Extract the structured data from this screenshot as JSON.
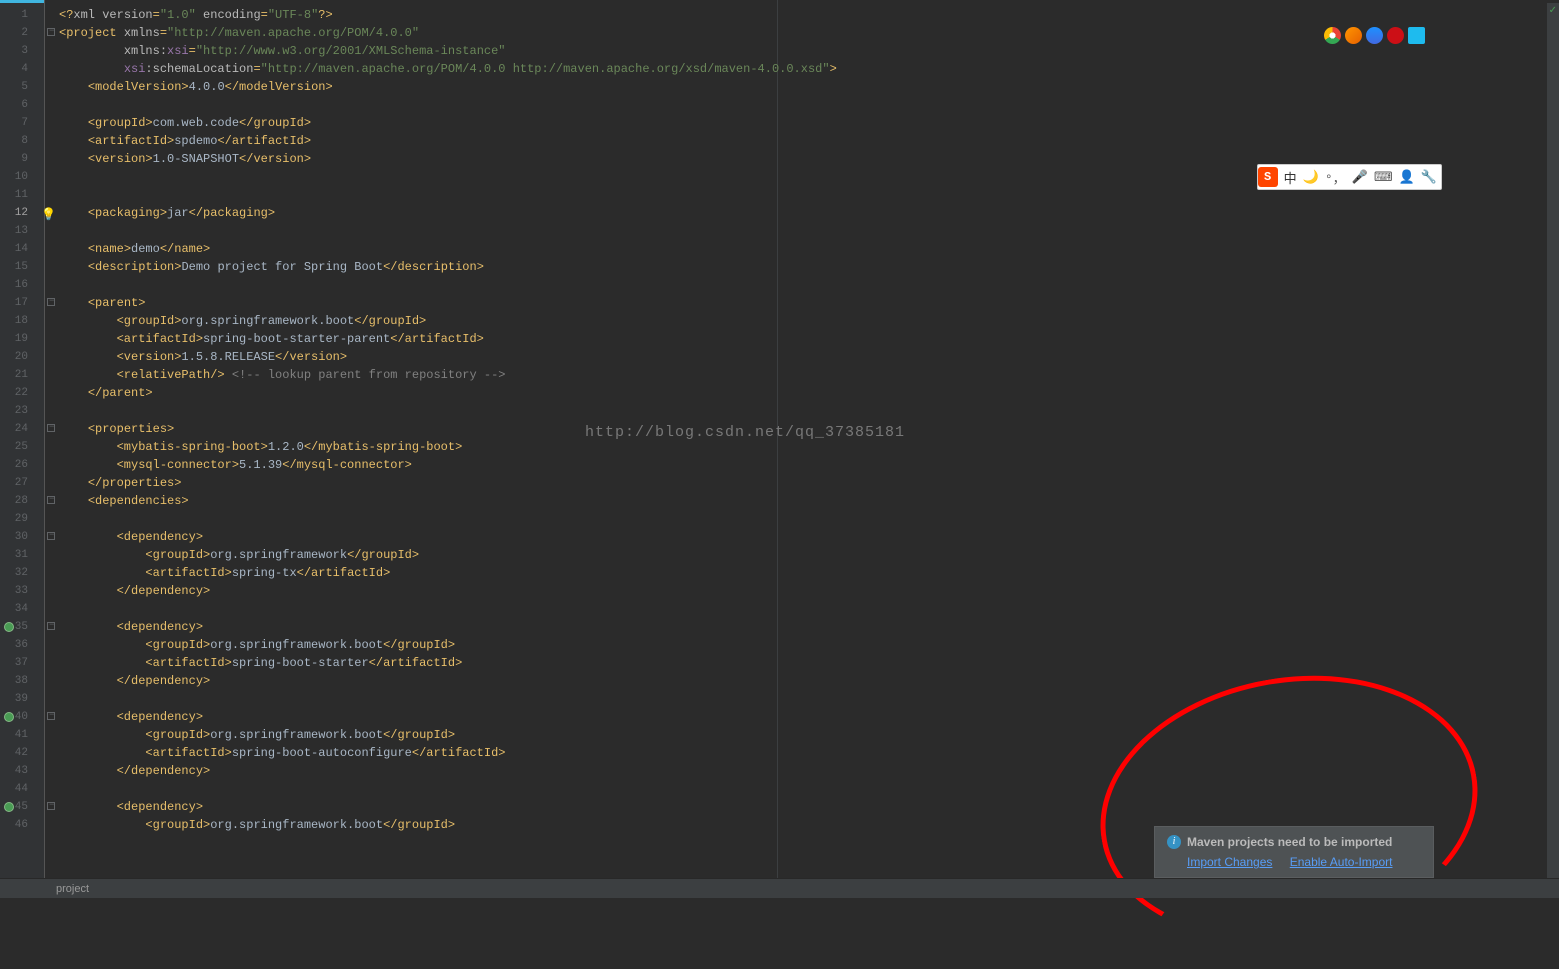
{
  "status_bar": {
    "breadcrumb": "project"
  },
  "notification": {
    "title": "Maven projects need to be imported",
    "link1": "Import Changes",
    "link2": "Enable Auto-Import"
  },
  "watermark": "http://blog.csdn.net/qq_37385181",
  "code": {
    "lines": [
      {
        "n": 1,
        "pre": "",
        "parts": [
          {
            "c": "tag",
            "t": "<?"
          },
          {
            "c": "attr",
            "t": "xml version"
          },
          {
            "c": "tag",
            "t": "="
          },
          {
            "c": "str",
            "t": "\"1.0\""
          },
          {
            "c": "attr",
            "t": " encoding"
          },
          {
            "c": "tag",
            "t": "="
          },
          {
            "c": "str",
            "t": "\"UTF-8\""
          },
          {
            "c": "tag",
            "t": "?>"
          }
        ]
      },
      {
        "n": 2,
        "pre": "",
        "fold": true,
        "parts": [
          {
            "c": "tag",
            "t": "<project "
          },
          {
            "c": "attr",
            "t": "xmlns"
          },
          {
            "c": "tag",
            "t": "="
          },
          {
            "c": "str",
            "t": "\"http://maven.apache.org/POM/4.0.0\""
          }
        ]
      },
      {
        "n": 3,
        "pre": "         ",
        "parts": [
          {
            "c": "attr",
            "t": "xmlns:"
          },
          {
            "c": "attrns",
            "t": "xsi"
          },
          {
            "c": "tag",
            "t": "="
          },
          {
            "c": "str",
            "t": "\"http://www.w3.org/2001/XMLSchema-instance\""
          }
        ]
      },
      {
        "n": 4,
        "pre": "         ",
        "parts": [
          {
            "c": "attrns",
            "t": "xsi"
          },
          {
            "c": "attr",
            "t": ":schemaLocation"
          },
          {
            "c": "tag",
            "t": "="
          },
          {
            "c": "str",
            "t": "\"http://maven.apache.org/POM/4.0.0 http://maven.apache.org/xsd/maven-4.0.0.xsd\""
          },
          {
            "c": "tag",
            "t": ">"
          }
        ]
      },
      {
        "n": 5,
        "pre": "    ",
        "parts": [
          {
            "c": "tag",
            "t": "<modelVersion>"
          },
          {
            "c": "txt",
            "t": "4.0.0"
          },
          {
            "c": "tag",
            "t": "</modelVersion>"
          }
        ]
      },
      {
        "n": 6,
        "pre": "",
        "parts": []
      },
      {
        "n": 7,
        "pre": "    ",
        "parts": [
          {
            "c": "tag",
            "t": "<groupId>"
          },
          {
            "c": "txt",
            "t": "com.web.code"
          },
          {
            "c": "tag",
            "t": "</groupId>"
          }
        ]
      },
      {
        "n": 8,
        "pre": "    ",
        "parts": [
          {
            "c": "tag",
            "t": "<artifactId>"
          },
          {
            "c": "txt",
            "t": "spdemo"
          },
          {
            "c": "tag",
            "t": "</artifactId>"
          }
        ]
      },
      {
        "n": 9,
        "pre": "    ",
        "parts": [
          {
            "c": "tag",
            "t": "<version>"
          },
          {
            "c": "txt",
            "t": "1.0-SNAPSHOT"
          },
          {
            "c": "tag",
            "t": "</version>"
          }
        ]
      },
      {
        "n": 10,
        "pre": "",
        "parts": []
      },
      {
        "n": 11,
        "pre": "",
        "parts": []
      },
      {
        "n": 12,
        "pre": "    ",
        "bulb": true,
        "active": true,
        "parts": [
          {
            "c": "tag",
            "t": "<packaging>"
          },
          {
            "c": "txt",
            "t": "jar"
          },
          {
            "c": "tag",
            "t": "</packaging>"
          }
        ]
      },
      {
        "n": 13,
        "pre": "",
        "parts": []
      },
      {
        "n": 14,
        "pre": "    ",
        "parts": [
          {
            "c": "tag",
            "t": "<name>"
          },
          {
            "c": "txt",
            "t": "demo"
          },
          {
            "c": "tag",
            "t": "</name>"
          }
        ]
      },
      {
        "n": 15,
        "pre": "    ",
        "parts": [
          {
            "c": "tag",
            "t": "<description>"
          },
          {
            "c": "txt",
            "t": "Demo project for Spring Boot"
          },
          {
            "c": "tag",
            "t": "</description>"
          }
        ]
      },
      {
        "n": 16,
        "pre": "",
        "parts": []
      },
      {
        "n": 17,
        "pre": "    ",
        "fold": true,
        "parts": [
          {
            "c": "tag",
            "t": "<parent>"
          }
        ]
      },
      {
        "n": 18,
        "pre": "        ",
        "parts": [
          {
            "c": "tag",
            "t": "<groupId>"
          },
          {
            "c": "txt",
            "t": "org.springframework.boot"
          },
          {
            "c": "tag",
            "t": "</groupId>"
          }
        ]
      },
      {
        "n": 19,
        "pre": "        ",
        "parts": [
          {
            "c": "tag",
            "t": "<artifactId>"
          },
          {
            "c": "txt",
            "t": "spring-boot-starter-parent"
          },
          {
            "c": "tag",
            "t": "</artifactId>"
          }
        ]
      },
      {
        "n": 20,
        "pre": "        ",
        "parts": [
          {
            "c": "tag",
            "t": "<version>"
          },
          {
            "c": "txt",
            "t": "1.5.8.RELEASE"
          },
          {
            "c": "tag",
            "t": "</version>"
          }
        ]
      },
      {
        "n": 21,
        "pre": "        ",
        "parts": [
          {
            "c": "tag",
            "t": "<relativePath/>"
          },
          {
            "c": "txt",
            "t": " "
          },
          {
            "c": "comment",
            "t": "<!-- lookup parent from repository -->"
          }
        ]
      },
      {
        "n": 22,
        "pre": "    ",
        "parts": [
          {
            "c": "tag",
            "t": "</parent>"
          }
        ]
      },
      {
        "n": 23,
        "pre": "",
        "parts": []
      },
      {
        "n": 24,
        "pre": "    ",
        "fold": true,
        "parts": [
          {
            "c": "tag",
            "t": "<properties>"
          }
        ]
      },
      {
        "n": 25,
        "pre": "        ",
        "parts": [
          {
            "c": "tag",
            "t": "<mybatis-spring-boot>"
          },
          {
            "c": "txt",
            "t": "1.2.0"
          },
          {
            "c": "tag",
            "t": "</mybatis-spring-boot>"
          }
        ]
      },
      {
        "n": 26,
        "pre": "        ",
        "parts": [
          {
            "c": "tag",
            "t": "<mysql-connector>"
          },
          {
            "c": "txt",
            "t": "5.1.39"
          },
          {
            "c": "tag",
            "t": "</mysql-connector>"
          }
        ]
      },
      {
        "n": 27,
        "pre": "    ",
        "parts": [
          {
            "c": "tag",
            "t": "</properties>"
          }
        ]
      },
      {
        "n": 28,
        "pre": "    ",
        "fold": true,
        "parts": [
          {
            "c": "tag",
            "t": "<dependencies>"
          }
        ]
      },
      {
        "n": 29,
        "pre": "",
        "parts": []
      },
      {
        "n": 30,
        "pre": "        ",
        "fold": true,
        "parts": [
          {
            "c": "tag",
            "t": "<dependency>"
          }
        ]
      },
      {
        "n": 31,
        "pre": "            ",
        "parts": [
          {
            "c": "tag",
            "t": "<groupId>"
          },
          {
            "c": "txt",
            "t": "org.springframework"
          },
          {
            "c": "tag",
            "t": "</groupId>"
          }
        ]
      },
      {
        "n": 32,
        "pre": "            ",
        "parts": [
          {
            "c": "tag",
            "t": "<artifactId>"
          },
          {
            "c": "txt",
            "t": "spring-tx"
          },
          {
            "c": "tag",
            "t": "</artifactId>"
          }
        ]
      },
      {
        "n": 33,
        "pre": "        ",
        "parts": [
          {
            "c": "tag",
            "t": "</dependency>"
          }
        ]
      },
      {
        "n": 34,
        "pre": "",
        "parts": []
      },
      {
        "n": 35,
        "pre": "        ",
        "fold": true,
        "impl": true,
        "parts": [
          {
            "c": "tag",
            "t": "<dependency>"
          }
        ]
      },
      {
        "n": 36,
        "pre": "            ",
        "parts": [
          {
            "c": "tag",
            "t": "<groupId>"
          },
          {
            "c": "txt",
            "t": "org.springframework.boot"
          },
          {
            "c": "tag",
            "t": "</groupId>"
          }
        ]
      },
      {
        "n": 37,
        "pre": "            ",
        "parts": [
          {
            "c": "tag",
            "t": "<artifactId>"
          },
          {
            "c": "txt",
            "t": "spring-boot-starter"
          },
          {
            "c": "tag",
            "t": "</artifactId>"
          }
        ]
      },
      {
        "n": 38,
        "pre": "        ",
        "parts": [
          {
            "c": "tag",
            "t": "</dependency>"
          }
        ]
      },
      {
        "n": 39,
        "pre": "",
        "parts": []
      },
      {
        "n": 40,
        "pre": "        ",
        "fold": true,
        "impl": true,
        "parts": [
          {
            "c": "tag",
            "t": "<dependency>"
          }
        ]
      },
      {
        "n": 41,
        "pre": "            ",
        "parts": [
          {
            "c": "tag",
            "t": "<groupId>"
          },
          {
            "c": "txt",
            "t": "org.springframework.boot"
          },
          {
            "c": "tag",
            "t": "</groupId>"
          }
        ]
      },
      {
        "n": 42,
        "pre": "            ",
        "parts": [
          {
            "c": "tag",
            "t": "<artifactId>"
          },
          {
            "c": "txt",
            "t": "spring-boot-autoconfigure"
          },
          {
            "c": "tag",
            "t": "</artifactId>"
          }
        ]
      },
      {
        "n": 43,
        "pre": "        ",
        "parts": [
          {
            "c": "tag",
            "t": "</dependency>"
          }
        ]
      },
      {
        "n": 44,
        "pre": "",
        "parts": []
      },
      {
        "n": 45,
        "pre": "        ",
        "fold": true,
        "impl": true,
        "parts": [
          {
            "c": "tag",
            "t": "<dependency>"
          }
        ]
      },
      {
        "n": 46,
        "pre": "            ",
        "parts": [
          {
            "c": "tag",
            "t": "<groupId>"
          },
          {
            "c": "txt",
            "t": "org.springframework.boot"
          },
          {
            "c": "tag",
            "t": "</groupId>"
          }
        ]
      }
    ]
  }
}
